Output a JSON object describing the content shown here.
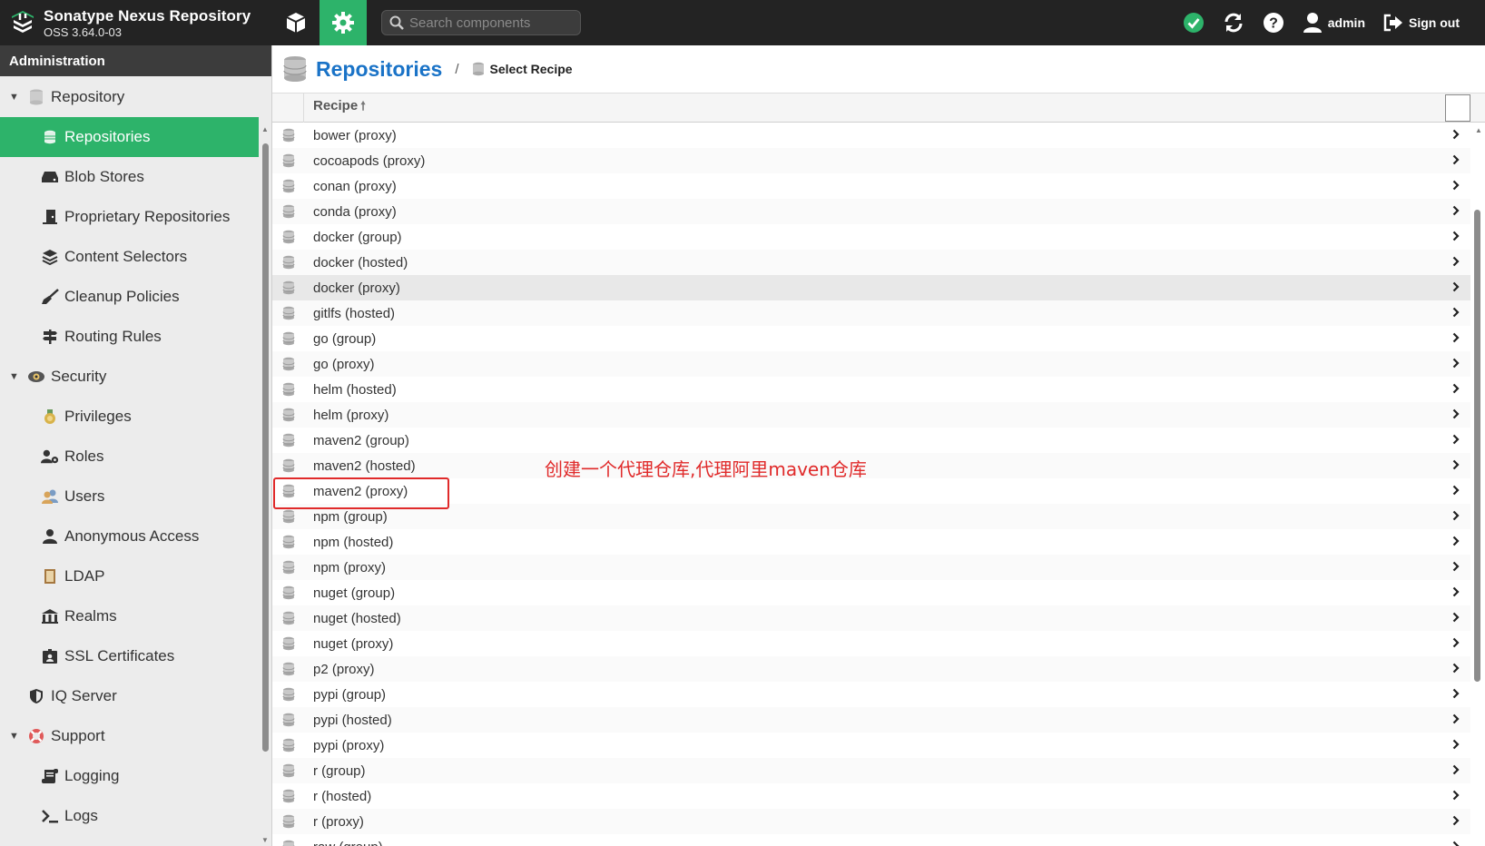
{
  "header": {
    "title": "Sonatype Nexus Repository",
    "version": "OSS 3.64.0-03",
    "search_placeholder": "Search components",
    "user_label": "admin",
    "signout_label": "Sign out"
  },
  "sidebar": {
    "header": "Administration",
    "items": [
      {
        "label": "Repository",
        "type": "group",
        "icon": "database-icon"
      },
      {
        "label": "Repositories",
        "type": "child",
        "icon": "database-icon",
        "active": true
      },
      {
        "label": "Blob Stores",
        "type": "child",
        "icon": "hard-drive-icon"
      },
      {
        "label": "Proprietary Repositories",
        "type": "child",
        "icon": "door-icon"
      },
      {
        "label": "Content Selectors",
        "type": "child",
        "icon": "layers-icon"
      },
      {
        "label": "Cleanup Policies",
        "type": "child",
        "icon": "broom-icon"
      },
      {
        "label": "Routing Rules",
        "type": "child",
        "icon": "signpost-icon"
      },
      {
        "label": "Security",
        "type": "group",
        "icon": "eye-badge-icon"
      },
      {
        "label": "Privileges",
        "type": "child",
        "icon": "medal-icon"
      },
      {
        "label": "Roles",
        "type": "child",
        "icon": "user-gear-icon"
      },
      {
        "label": "Users",
        "type": "child",
        "icon": "users-icon"
      },
      {
        "label": "Anonymous Access",
        "type": "child",
        "icon": "user-icon"
      },
      {
        "label": "LDAP",
        "type": "child",
        "icon": "book-icon"
      },
      {
        "label": "Realms",
        "type": "child",
        "icon": "building-icon"
      },
      {
        "label": "SSL Certificates",
        "type": "child",
        "icon": "id-badge-icon"
      },
      {
        "label": "IQ Server",
        "type": "group-leaf",
        "icon": "shield-icon"
      },
      {
        "label": "Support",
        "type": "group",
        "icon": "lifebuoy-icon"
      },
      {
        "label": "Logging",
        "type": "child",
        "icon": "scroll-icon"
      },
      {
        "label": "Logs",
        "type": "child",
        "icon": "terminal-icon"
      }
    ]
  },
  "breadcrumb": {
    "title": "Repositories",
    "separator": "/",
    "current": "Select Recipe"
  },
  "grid": {
    "column_recipe": "Recipe",
    "rows": [
      "bower (proxy)",
      "cocoapods (proxy)",
      "conan (proxy)",
      "conda (proxy)",
      "docker (group)",
      "docker (hosted)",
      "docker (proxy)",
      "gitlfs (hosted)",
      "go (group)",
      "go (proxy)",
      "helm (hosted)",
      "helm (proxy)",
      "maven2 (group)",
      "maven2 (hosted)",
      "maven2 (proxy)",
      "npm (group)",
      "npm (hosted)",
      "npm (proxy)",
      "nuget (group)",
      "nuget (hosted)",
      "nuget (proxy)",
      "p2 (proxy)",
      "pypi (group)",
      "pypi (hosted)",
      "pypi (proxy)",
      "r (group)",
      "r (hosted)",
      "r (proxy)",
      "raw (group)"
    ],
    "hover_row": "docker (proxy)",
    "highlighted_row": "maven2 (proxy)"
  },
  "annotation": {
    "text": "创建一个代理仓库,代理阿里maven仓库",
    "color": "#e02a2a"
  },
  "colors": {
    "topbar": "#232323",
    "accent": "#2db36a",
    "link": "#1a73c7",
    "status_ok": "#2db36a"
  }
}
